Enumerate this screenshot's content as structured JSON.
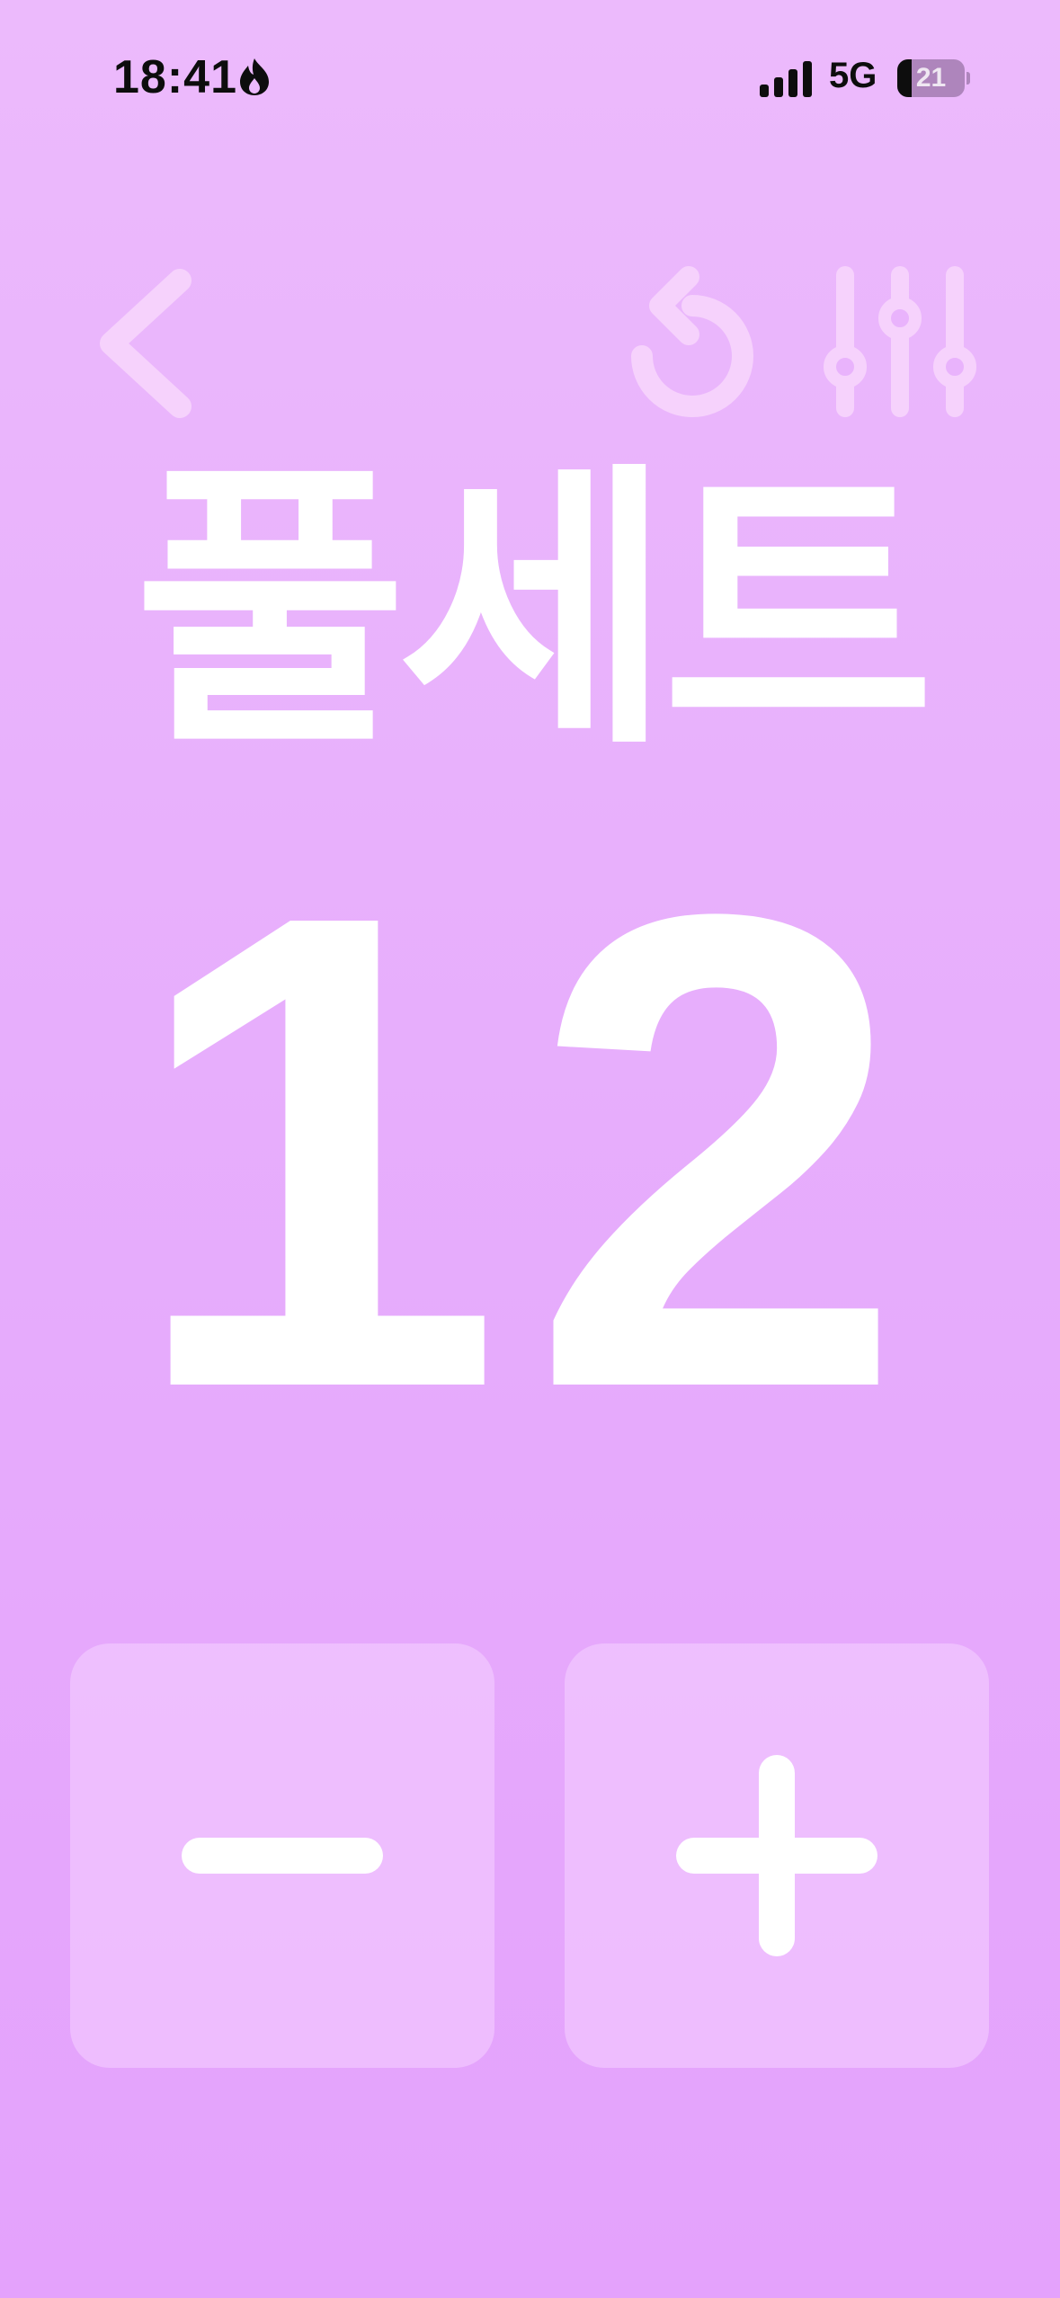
{
  "status_bar": {
    "time": "18:41",
    "network": "5G",
    "battery": "21",
    "battery_level": 0.21,
    "icons": [
      "flame-icon",
      "cellular-signal-icon",
      "battery-icon"
    ]
  },
  "toolbar": {
    "icons": [
      "chevron-left-icon",
      "reset-icon",
      "sliders-icon"
    ]
  },
  "title": "풀세트",
  "counter": {
    "value": "12"
  },
  "controls": {
    "icons": [
      "minus-icon",
      "plus-icon"
    ]
  },
  "colors": {
    "background_top": "#ecbafc",
    "background_bottom": "#e4a2fc",
    "foreground": "#ffffff",
    "button_fill": "#f5d2ff"
  }
}
